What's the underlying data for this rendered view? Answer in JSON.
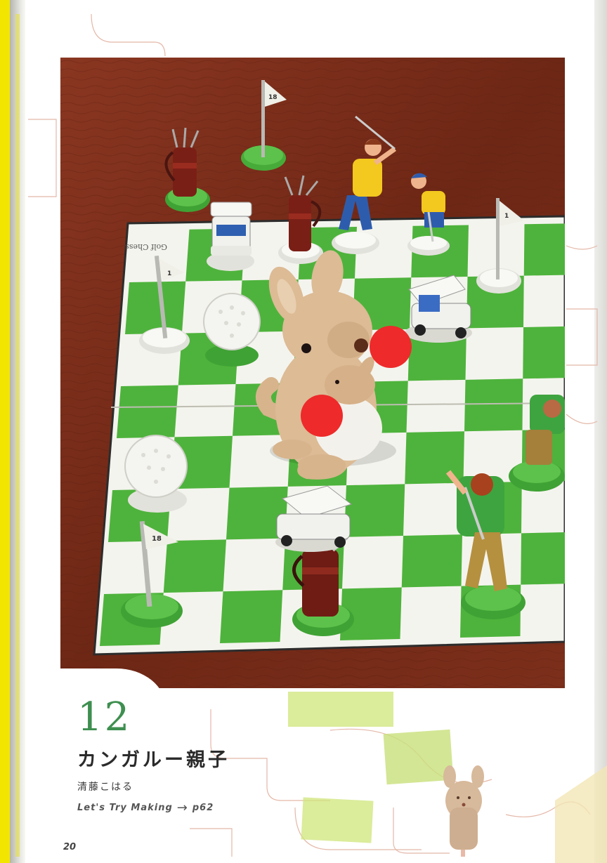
{
  "page": {
    "number": "20",
    "item_number": "12",
    "title": "カンガルー親子",
    "author": "清藤こはる",
    "lets_try": {
      "text": "Let's Try Making",
      "arrow": "→",
      "page_ref": "p62"
    }
  },
  "photo": {
    "board_text": "Golf Chess",
    "flag_numbers": [
      "18",
      "1",
      "1",
      "18"
    ]
  },
  "colors": {
    "number_green": "#3e8f50",
    "board_green": "#4eb33c",
    "table_wood": "#7a2e1a",
    "binding_yellow": "#f2e600"
  }
}
